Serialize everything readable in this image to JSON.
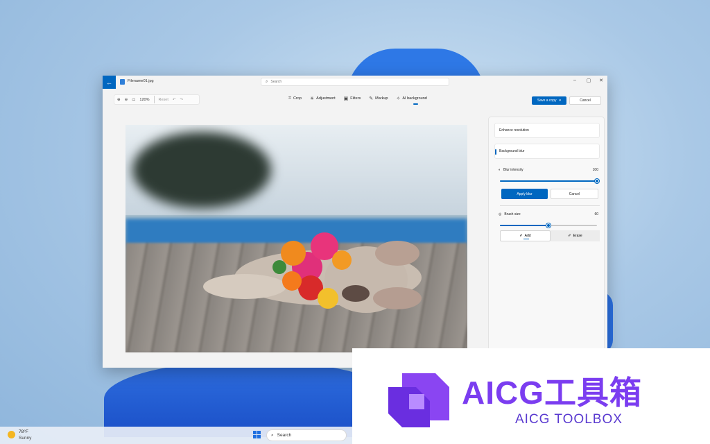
{
  "window": {
    "file_name": "Filename01.jpg",
    "search_placeholder": "Search",
    "back_icon": "back-arrow-icon"
  },
  "toolbar": {
    "zoom": "120%",
    "reset": "Reset",
    "tools": [
      {
        "label": "Crop",
        "icon": "crop-icon"
      },
      {
        "label": "Adjustment",
        "icon": "adjustment-icon"
      },
      {
        "label": "Filters",
        "icon": "filters-icon"
      },
      {
        "label": "Markup",
        "icon": "markup-icon"
      },
      {
        "label": "AI background",
        "icon": "ai-background-icon",
        "active": true
      }
    ],
    "save_label": "Save a copy",
    "cancel_label": "Cancel"
  },
  "panel": {
    "enhance_label": "Enhance resolution",
    "background_blur_label": "Background blur",
    "blur_intensity_label": "Blur intensity",
    "blur_intensity_value": "100",
    "blur_intensity_fraction": 1.0,
    "apply_label": "Apply blur",
    "cancel_label": "Cancel",
    "brush_size_label": "Brush size",
    "brush_size_value": "60",
    "brush_size_fraction": 0.5,
    "add_label": "Add",
    "erase_label": "Erase"
  },
  "taskbar": {
    "temperature": "78°F",
    "condition": "Sunny",
    "search_label": "Search"
  },
  "watermark": {
    "title": "AICG工具箱",
    "subtitle": "AICG TOOLBOX"
  },
  "colors": {
    "accent": "#0067c0",
    "watermark_purple": "#7b3df0"
  }
}
